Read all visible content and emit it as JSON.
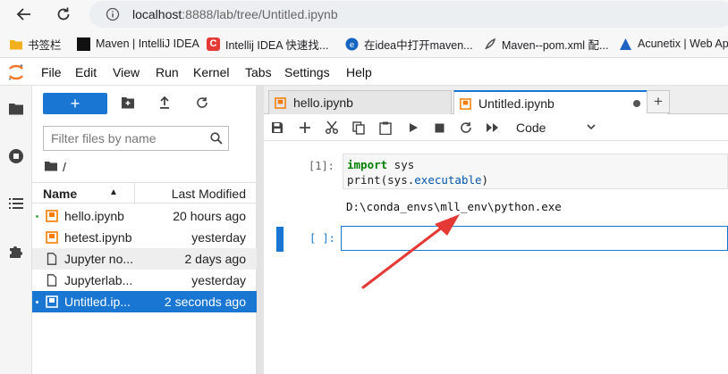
{
  "browser": {
    "url_host": "localhost",
    "url_rest": ":8888/lab/tree/Untitled.ipynb",
    "bookmarks": [
      {
        "label": "书签栏",
        "icon": "folder-icon",
        "color": "#f2b01e"
      },
      {
        "label": "Maven | IntelliJ IDEA",
        "icon": "intellij-icon",
        "color": "#111111"
      },
      {
        "label": "Intellij IDEA 快速找...",
        "icon": "c-brand-icon",
        "color": "#e53935"
      },
      {
        "label": "在idea中打开maven...",
        "icon": "edge-icon",
        "color": "#1565c0"
      },
      {
        "label": "Maven--pom.xml 配...",
        "icon": "feather-icon",
        "color": "#555555"
      },
      {
        "label": "Acunetix | Web App",
        "icon": "acunetix-icon",
        "color": "#1e63c4"
      }
    ]
  },
  "menu": [
    "File",
    "Edit",
    "View",
    "Run",
    "Kernel",
    "Tabs",
    "Settings",
    "Help"
  ],
  "file_browser": {
    "new_label": "+",
    "filter_placeholder": "Filter files by name",
    "breadcrumb": "/",
    "col_name": "Name",
    "col_modified": "Last Modified",
    "files": [
      {
        "name": "hello.ipynb",
        "modified": "20 hours ago",
        "type": "notebook",
        "running": true,
        "state": "normal"
      },
      {
        "name": "hetest.ipynb",
        "modified": "yesterday",
        "type": "notebook",
        "running": false,
        "state": "normal"
      },
      {
        "name": "Jupyter no...",
        "modified": "2 days ago",
        "type": "file",
        "running": false,
        "state": "hover"
      },
      {
        "name": "Jupyterlab...",
        "modified": "yesterday",
        "type": "file",
        "running": false,
        "state": "normal"
      },
      {
        "name": "Untitled.ip...",
        "modified": "2 seconds ago",
        "type": "notebook",
        "running": true,
        "state": "selected"
      }
    ]
  },
  "tabs": [
    {
      "label": "hello.ipynb",
      "active": false
    },
    {
      "label": "Untitled.ipynb",
      "active": true
    }
  ],
  "toolbar": {
    "cell_type": "Code"
  },
  "cells": {
    "executed_prompt": "[1]:",
    "code_line1_kw": "import",
    "code_line1_rest": " sys",
    "code_line2_pre": "print(sys.",
    "code_line2_attr": "executable",
    "code_line2_post": ")",
    "output": "D:\\conda_envs\\mll_env\\python.exe",
    "empty_prompt": "[ ]:"
  },
  "colors": {
    "accent": "#1976d2",
    "annotation_arrow": "#e53935",
    "notebook_icon": "#f57c00"
  }
}
